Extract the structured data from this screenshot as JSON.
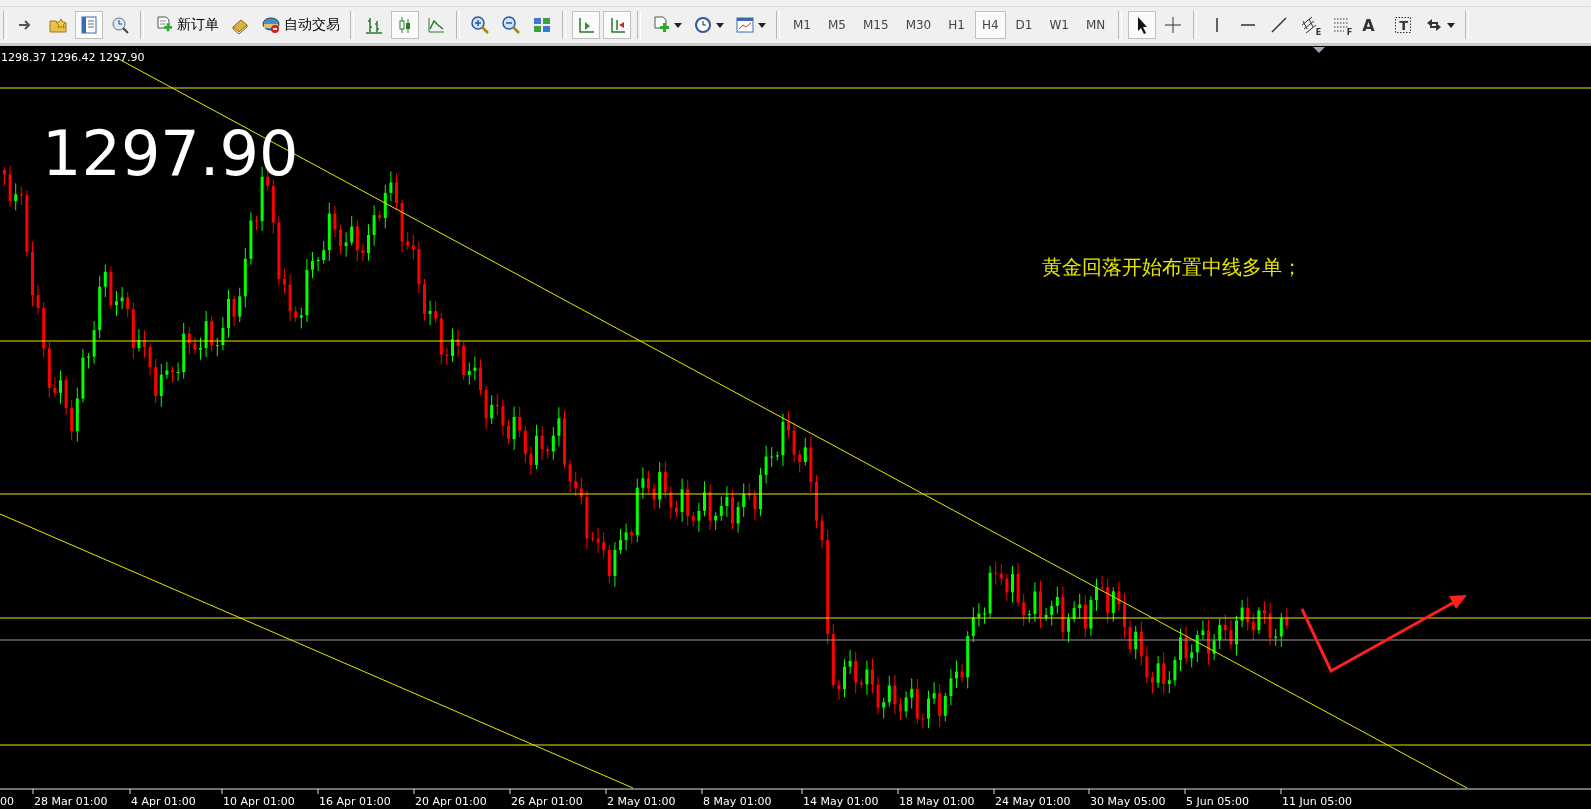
{
  "toolbar": {
    "tool_groups": [
      [
        {
          "kind": "navigator",
          "pressed": false
        },
        {
          "kind": "favorites",
          "pressed": false
        },
        {
          "kind": "market",
          "pressed": true
        },
        {
          "kind": "tester",
          "pressed": false
        }
      ],
      [
        {
          "kind": "new-order",
          "label": "新订单",
          "pressed": false
        },
        {
          "kind": "editor",
          "pressed": false
        },
        {
          "kind": "auto-trading",
          "label": "自动交易",
          "pressed": false
        }
      ],
      [
        {
          "kind": "bar-chart",
          "pressed": false
        },
        {
          "kind": "candles",
          "pressed": true
        },
        {
          "kind": "line-chart",
          "pressed": false
        }
      ],
      [
        {
          "kind": "zoom-in",
          "pressed": false
        },
        {
          "kind": "zoom-out",
          "pressed": false
        },
        {
          "kind": "tile",
          "pressed": false
        }
      ],
      [
        {
          "kind": "autoscroll",
          "pressed": true
        },
        {
          "kind": "chart-shift",
          "pressed": true
        }
      ],
      [
        {
          "kind": "indicators",
          "pressed": false,
          "menu": true
        },
        {
          "kind": "periods",
          "pressed": false,
          "menu": true
        },
        {
          "kind": "templates",
          "pressed": false,
          "menu": true
        }
      ]
    ],
    "timeframes": [
      {
        "label": "M1",
        "selected": false
      },
      {
        "label": "M5",
        "selected": false
      },
      {
        "label": "M15",
        "selected": false
      },
      {
        "label": "M30",
        "selected": false
      },
      {
        "label": "H1",
        "selected": false
      },
      {
        "label": "H4",
        "selected": true
      },
      {
        "label": "D1",
        "selected": false
      },
      {
        "label": "W1",
        "selected": false
      },
      {
        "label": "MN",
        "selected": false
      }
    ],
    "drawing_groups": [
      [
        {
          "kind": "cursor",
          "pressed": true
        },
        {
          "kind": "crosshair",
          "pressed": false
        }
      ],
      [
        {
          "kind": "vline",
          "pressed": false
        },
        {
          "kind": "hline",
          "pressed": false
        },
        {
          "kind": "trendline",
          "pressed": false
        },
        {
          "kind": "fibo-channel",
          "label": "E",
          "pressed": false
        },
        {
          "kind": "fibo",
          "label": "F",
          "pressed": false
        },
        {
          "kind": "text",
          "label": "A",
          "pressed": false
        },
        {
          "kind": "text-label",
          "label": "T",
          "pressed": false
        },
        {
          "kind": "arrows",
          "pressed": false,
          "menu": true
        }
      ]
    ]
  },
  "chart": {
    "ohlc": "1298.37 1296.42 1297.90",
    "price": "1297.90",
    "note": "黄金回落开始布置中线多单；",
    "x_labels": [
      "00",
      "28 Mar 01:00",
      "4 Apr 01:00",
      "10 Apr 01:00",
      "16 Apr 01:00",
      "20 Apr 01:00",
      "26 Apr 01:00",
      "2 May 01:00",
      "8 May 01:00",
      "14 May 01:00",
      "18 May 01:00",
      "24 May 01:00",
      "30 May 05:00",
      "5 Jun 05:00",
      "11 Jun 05:00"
    ]
  }
}
